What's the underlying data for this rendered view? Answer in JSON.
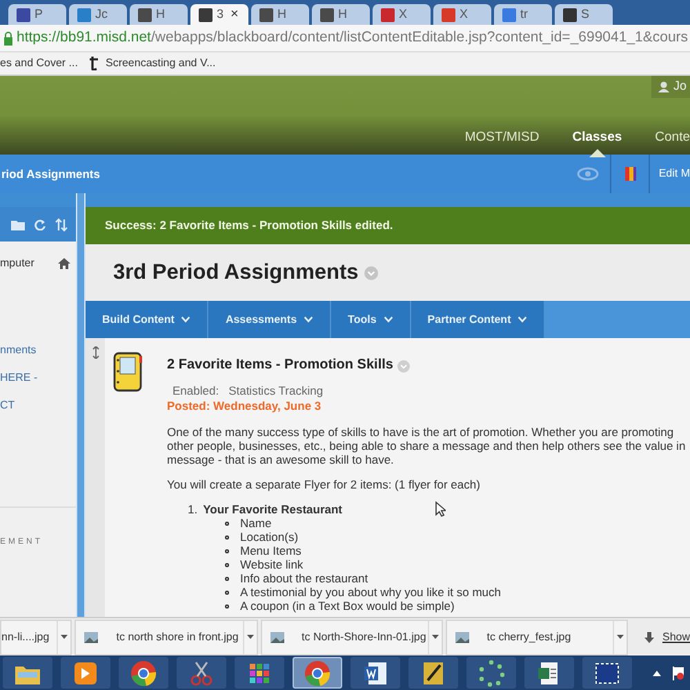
{
  "browser": {
    "tabs": [
      {
        "label": "P",
        "color": "#3b4aa0",
        "selected": false
      },
      {
        "label": "Jc",
        "color": "#2a7fc9",
        "selected": false
      },
      {
        "label": "H",
        "color": "#4a4a4a",
        "selected": false
      },
      {
        "label": "3",
        "color": "#3a3a3a",
        "selected": true
      },
      {
        "label": "H",
        "color": "#4a4a4a",
        "selected": false
      },
      {
        "label": "H",
        "color": "#4a4a4a",
        "selected": false
      },
      {
        "label": "X",
        "color": "#c8282e",
        "selected": false
      },
      {
        "label": "X",
        "color": "#d83a2a",
        "selected": false
      },
      {
        "label": "tr",
        "color": "#3b7be0",
        "selected": false
      },
      {
        "label": "S",
        "color": "#333333",
        "selected": false
      }
    ],
    "close": "×",
    "url": {
      "host": "https://bb91.misd.net",
      "path": "/webapps/blackboard/content/listContentEditable.jsp?content_id=_699041_1&cours"
    },
    "bookmarks": [
      {
        "label": "es and Cover ...",
        "icon": false
      },
      {
        "label": "Screencasting and V...",
        "icon": true
      }
    ]
  },
  "header": {
    "user": "Jo",
    "nav": [
      {
        "label": "MOST/MISD",
        "selected": false
      },
      {
        "label": "Classes",
        "selected": true
      },
      {
        "label": "Conte",
        "selected": false
      }
    ]
  },
  "course_bar": {
    "title": "riod Assignments",
    "edit": "Edit M"
  },
  "sidebar": {
    "items": [
      "mputer",
      "nments",
      "HERE -",
      "CT"
    ],
    "section": "EMENT"
  },
  "success": "Success: 2 Favorite Items - Promotion Skills edited.",
  "page_title": "3rd Period Assignments",
  "action_bar": [
    "Build Content",
    "Assessments",
    "Tools",
    "Partner Content"
  ],
  "item": {
    "title": "2 Favorite Items - Promotion Skills",
    "enabled": "Enabled:",
    "tracking": "Statistics Tracking",
    "posted": "Posted: Wednesday, June 3",
    "paragraph": [
      "One of the many success type of skills to have is the art of promotion.  Whether you are promoting",
      "other people, businesses, etc., being able to share a message and then help others see the value in",
      "message - that is an awesome skill to have."
    ],
    "intro": "You will create a separate Flyer for 2 items: (1 flyer for each)",
    "list": [
      {
        "number": "1.",
        "title": "Your Favorite Restaurant",
        "bullets": [
          "Name",
          "Location(s)",
          "Menu Items",
          "Website link",
          "Info about the restaurant",
          "A testimonial by you about why you like it so much",
          "A coupon (in a Text Box would be simple)"
        ]
      }
    ]
  },
  "downloads": [
    {
      "label": "nn-li....jpg",
      "icon": false
    },
    {
      "label": "tc north shore in front.jpg",
      "icon": true
    },
    {
      "label": "tc North-Shore-Inn-01.jpg",
      "icon": true
    },
    {
      "label": "tc cherry_fest.jpg",
      "icon": true
    }
  ],
  "show_all": "Show",
  "taskbar": [
    {
      "kind": "folder",
      "selected": false
    },
    {
      "kind": "media",
      "selected": false
    },
    {
      "kind": "chrome",
      "selected": false
    },
    {
      "kind": "scissors",
      "selected": false
    },
    {
      "kind": "grid",
      "selected": false
    },
    {
      "kind": "chrome",
      "selected": true
    },
    {
      "kind": "word",
      "selected": false
    },
    {
      "kind": "notebook",
      "selected": false
    },
    {
      "kind": "dots",
      "selected": false
    },
    {
      "kind": "document",
      "selected": false
    },
    {
      "kind": "capture",
      "selected": false
    }
  ]
}
